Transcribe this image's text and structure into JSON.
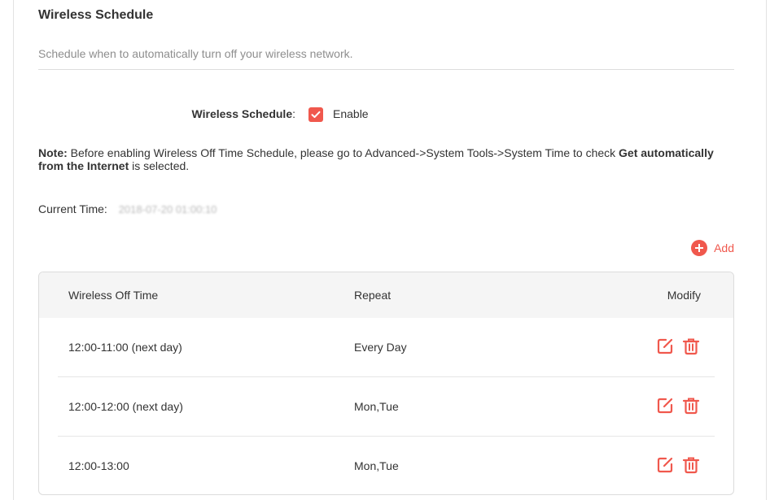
{
  "header": {
    "title": "Wireless Schedule",
    "subtitle": "Schedule when to automatically turn off your wireless network."
  },
  "schedule": {
    "label": "Wireless Schedule",
    "colon": ":",
    "enable_label": "Enable",
    "enabled": true
  },
  "note": {
    "prefix": "Note:",
    "text1": " Before enabling Wireless Off Time Schedule, please go to Advanced->System Tools->System Time to check ",
    "bold": "Get automatically from the Internet",
    "text2": " is selected."
  },
  "current_time": {
    "label": "Current Time:",
    "value": "2018-07-20 01:00:10"
  },
  "add_button": {
    "label": "Add"
  },
  "table": {
    "headers": {
      "off_time": "Wireless Off Time",
      "repeat": "Repeat",
      "modify": "Modify"
    },
    "rows": [
      {
        "off_time": "12:00-11:00 (next day)",
        "repeat": "Every Day"
      },
      {
        "off_time": "12:00-12:00 (next day)",
        "repeat": "Mon,Tue"
      },
      {
        "off_time": "12:00-13:00",
        "repeat": "Mon,Tue"
      }
    ]
  },
  "colors": {
    "accent": "#f0584d",
    "muted_text": "#8e8e8e",
    "header_bg": "#f5f5f5"
  },
  "icons": {
    "edit": "edit-icon",
    "delete": "trash-icon",
    "add": "plus-circle-icon",
    "check": "checkmark-icon"
  }
}
